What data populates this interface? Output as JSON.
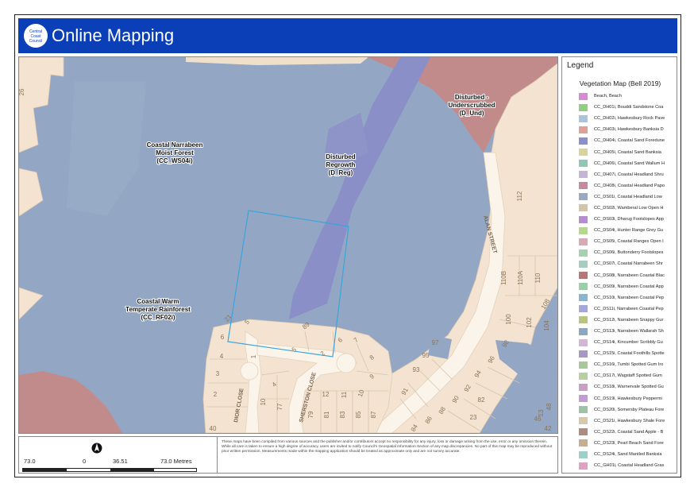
{
  "header": {
    "logo_text": "Central Coast Council",
    "title": "Online Mapping"
  },
  "map": {
    "veg_labels": [
      {
        "lines": [
          "Coastal Narrabeen",
          "Moist Forest",
          "(CC_WS04i)"
        ]
      },
      {
        "lines": [
          "Disturbed",
          "Regrowth",
          "(D_Reg)"
        ]
      },
      {
        "lines": [
          "Disturbed -",
          "Underscrubbed",
          "(D_Und)"
        ]
      },
      {
        "lines": [
          "Coastal Warm",
          "Temperate Rainforest",
          "(CC_RF02i)"
        ]
      }
    ],
    "street_labels": [
      "ALAN STREET",
      "DIOR CLOSE",
      "SHERSTON CLOSE"
    ],
    "lot_numbers": [
      "26",
      "112",
      "110B",
      "110A",
      "110",
      "108",
      "100",
      "102",
      "104",
      "98",
      "97",
      "95",
      "96",
      "93",
      "94",
      "92",
      "91",
      "90",
      "88",
      "86",
      "84",
      "82",
      "23",
      "21",
      "5",
      "6",
      "4",
      "3",
      "2",
      "1",
      "10",
      "77",
      "79",
      "81",
      "83",
      "85",
      "87",
      "89",
      "5",
      "4",
      "2",
      "6",
      "7",
      "8",
      "9",
      "10",
      "11",
      "12",
      "13",
      "48",
      "46",
      "42",
      "40",
      "31"
    ]
  },
  "legend": {
    "title": "Legend",
    "subtitle": "Vegetation Map (Bell 2019)",
    "items": [
      {
        "label": "Beach, Beach",
        "color": "#d98bd1"
      },
      {
        "label": "CC_DH01i, Bouddi Sandstone Coa",
        "color": "#8fcf7f"
      },
      {
        "label": "CC_DH02i, Hawkesbury Rock Pave",
        "color": "#a9c4dc"
      },
      {
        "label": "CC_DH03i, Hawkesbury Banksia D",
        "color": "#e0a09a"
      },
      {
        "label": "CC_DH04i, Coastal Sand Foredune",
        "color": "#8a8fce"
      },
      {
        "label": "CC_DH05i, Coastal Sand Banksia",
        "color": "#d8d49a"
      },
      {
        "label": "CC_DH06i, Coastal Sand Wallum H",
        "color": "#8ec8b2"
      },
      {
        "label": "CC_DH07i, Coastal Headland Shru",
        "color": "#c4b4d8"
      },
      {
        "label": "CC_DH08i, Coastal Headland Papo",
        "color": "#c48aa0"
      },
      {
        "label": "CC_DS01i, Coastal Headland Low",
        "color": "#9aa8c4"
      },
      {
        "label": "CC_DS02i, Wamberal Low Open H",
        "color": "#d6c4a8"
      },
      {
        "label": "CC_DS03i, Dharug Footslopes App",
        "color": "#b48cd0"
      },
      {
        "label": "CC_DS04i, Hunter Range Grey Gu",
        "color": "#b4d88c"
      },
      {
        "label": "CC_DS05i, Coastal Ranges Open I",
        "color": "#d8a8b4"
      },
      {
        "label": "CC_DS06i, Buttonderry Footslopes",
        "color": "#a8d0b0"
      },
      {
        "label": "CC_DS07i, Coastal Narrabeen Shr",
        "color": "#a8ccc0"
      },
      {
        "label": "CC_DS08i, Narrabeen Coastal Blac",
        "color": "#b47878"
      },
      {
        "label": "CC_DS09i, Narrabeen Coastal App",
        "color": "#9ccfa8"
      },
      {
        "label": "CC_DS10i, Narrabeen Coastal Pep",
        "color": "#8cb4cc"
      },
      {
        "label": "CC_DS11i, Narrabeen Coastal Pep",
        "color": "#a4a8d8"
      },
      {
        "label": "CC_DS12i, Narrabeen Snappy Gur",
        "color": "#b8c480"
      },
      {
        "label": "CC_DS13i, Narrabeen Wallarah Sh",
        "color": "#8aa8c4"
      },
      {
        "label": "CC_DS14i, Kincumber Scribbly Gu",
        "color": "#d4b4d8"
      },
      {
        "label": "CC_DS15i, Coastal Foothills Spotte",
        "color": "#a898c8"
      },
      {
        "label": "CC_DS16i, Tumbi Spotted Gum Iro",
        "color": "#a8c89c"
      },
      {
        "label": "CC_DS17i, Wagstaff Spotted Gum",
        "color": "#b8d0a0"
      },
      {
        "label": "CC_DS18i, Warnervale Spotted Gu",
        "color": "#c8a0c4"
      },
      {
        "label": "CC_DS19i, Hawkesbury Peppermi",
        "color": "#c49cd4"
      },
      {
        "label": "CC_DS20i, Somersby Plateau Fore",
        "color": "#9cc4a4"
      },
      {
        "label": "CC_DS21i, Hawkesbury Shale Fore",
        "color": "#d8c8a8"
      },
      {
        "label": "CC_DS22i, Coastal Sand Apple - B",
        "color": "#b08c80"
      },
      {
        "label": "CC_DS23i, Pearl Beach Sand Fore",
        "color": "#c4b08c"
      },
      {
        "label": "CC_DS24i, Sand Mantled Banksia",
        "color": "#9cd0c8"
      },
      {
        "label": "CC_GH01i, Coastal Headland Gras",
        "color": "#dca4c0"
      }
    ]
  },
  "scale": {
    "labels": [
      "73.0",
      "0",
      "36.51",
      "73.0 Metres"
    ]
  },
  "disclaimer": "These maps have been compiled from various sources and the publisher and/or contributors accept no responsibility for any injury, loss or damage arising from the use, error or any omission therein. While all care is taken to ensure a high degree of accuracy, users are invited to notify Council's Geospatial Information Section of any map discrepancies. No part of this map may be reproduced without prior written permission. Measurements made within the mapping application should be treated as approximate only and are not survey accurate."
}
